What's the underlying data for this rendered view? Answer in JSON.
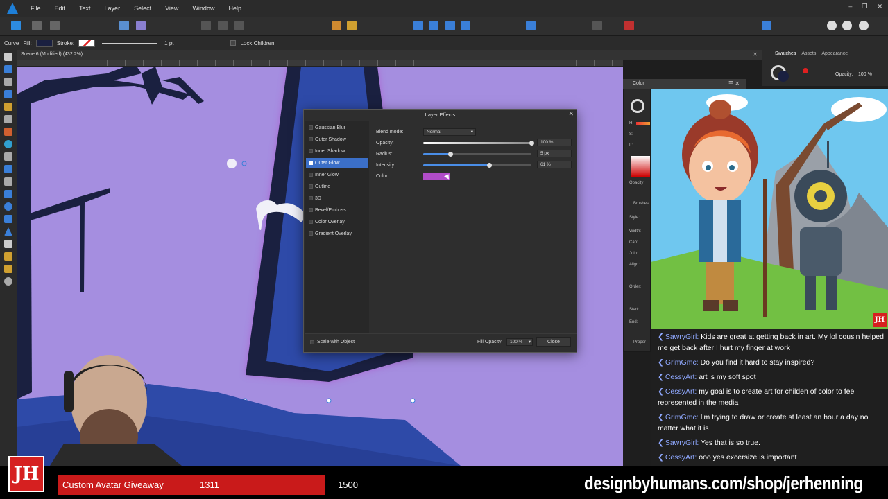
{
  "menubar": {
    "items": [
      "File",
      "Edit",
      "Text",
      "Layer",
      "Select",
      "View",
      "Window",
      "Help"
    ]
  },
  "contextbar": {
    "mode": "Curve",
    "fill_label": "Fill:",
    "stroke_label": "Stroke:",
    "stroke_width": "1 pt",
    "lock_children": "Lock Children",
    "fill_color": "#1a2040"
  },
  "document": {
    "tab_title": "Scene 6 (Modified) (432.2%)"
  },
  "right_panel": {
    "tabs": [
      "Swatches",
      "Assets",
      "Appearance"
    ],
    "opacity_label": "Opacity:",
    "opacity_value": "100 %"
  },
  "color_panel": {
    "title": "Color",
    "labels": [
      "H:",
      "S:",
      "L:",
      "Opacity",
      "Brushes",
      "Style:",
      "Width:",
      "Cap:",
      "Join:",
      "Align:",
      "Order:",
      "Start:",
      "End:",
      "Proper"
    ]
  },
  "dialog": {
    "title": "Layer Effects",
    "effects": [
      {
        "label": "Gaussian Blur",
        "checked": false
      },
      {
        "label": "Outer Shadow",
        "checked": false
      },
      {
        "label": "Inner Shadow",
        "checked": false
      },
      {
        "label": "Outer Glow",
        "checked": true
      },
      {
        "label": "Inner Glow",
        "checked": false
      },
      {
        "label": "Outline",
        "checked": false
      },
      {
        "label": "3D",
        "checked": false
      },
      {
        "label": "Bevel/Emboss",
        "checked": false
      },
      {
        "label": "Color Overlay",
        "checked": false
      },
      {
        "label": "Gradient Overlay",
        "checked": false
      }
    ],
    "blend_mode_label": "Blend mode:",
    "blend_mode_value": "Normal",
    "opacity_label": "Opacity:",
    "opacity_value": "100 %",
    "opacity_level": 1.0,
    "radius_label": "Radius:",
    "radius_value": "5 px",
    "radius_level": 0.25,
    "intensity_label": "Intensity:",
    "intensity_value": "61 %",
    "intensity_level": 0.61,
    "color_label": "Color:",
    "glow_color": "#b04cc8",
    "scale_with_object": "Scale with Object",
    "fill_opacity_label": "Fill Opacity:",
    "fill_opacity_value": "100 %",
    "close_label": "Close"
  },
  "chat": [
    {
      "user": "SawryGirl:",
      "text": "Kids are great at getting back in art. My lol cousin helped me get back after I hurt my finger at work"
    },
    {
      "user": "GrimGmc:",
      "text": "Do you find it hard to stay inspired?"
    },
    {
      "user": "CessyArt:",
      "text": "art is my soft spot"
    },
    {
      "user": "CessyArt:",
      "text": "my goal is to create art for childen of color to feel represented in the media"
    },
    {
      "user": "GrimGmc:",
      "text": "I'm trying to draw or create st least an hour a day no matter what it is"
    },
    {
      "user": "SawryGirl:",
      "text": "Yes that is so true."
    },
    {
      "user": "CessyArt:",
      "text": "ooo yes excersize is important"
    }
  ],
  "stream": {
    "logo_text": "JH",
    "goal_label": "Custom Avatar Giveaway",
    "goal_current": "1311",
    "goal_target": "1500",
    "goal_progress": 0.874,
    "shop_url": "designbyhumans.com/shop/jerhenning"
  },
  "colors": {
    "canvas": "#a58ee0",
    "accent": "#3b6fc8",
    "goal_red": "#c91a1a"
  }
}
